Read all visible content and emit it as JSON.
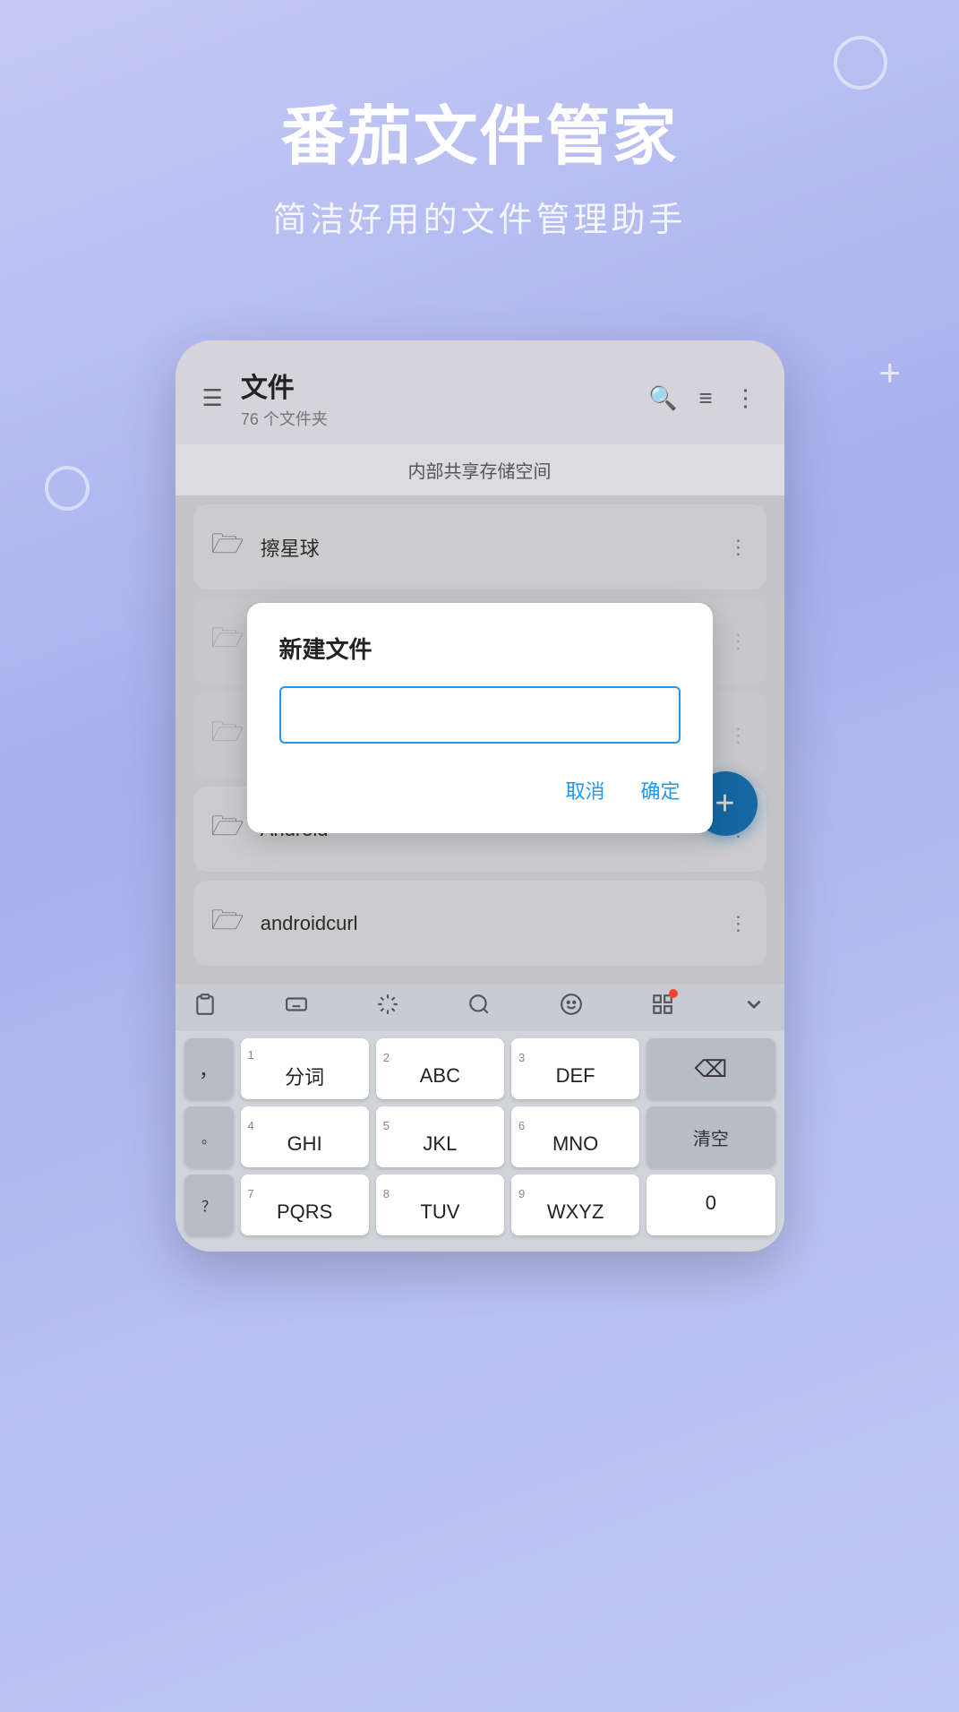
{
  "hero": {
    "title": "番茄文件管家",
    "subtitle": "简洁好用的文件管理助手"
  },
  "app": {
    "header": {
      "title": "文件",
      "subtitle": "76 个文件夹",
      "menu_icon": "≡",
      "search_icon": "🔍",
      "sort_icon": "≡",
      "more_icon": "⋮"
    },
    "storage_path": "内部共享存储空间",
    "files": [
      {
        "name": "擦星球",
        "icon": "□"
      },
      {
        "name": "Android",
        "icon": "□"
      },
      {
        "name": "androidcurl",
        "icon": "□"
      }
    ]
  },
  "dialog": {
    "title": "新建文件",
    "input_value": "",
    "input_placeholder": "",
    "cancel_label": "取消",
    "confirm_label": "确定"
  },
  "fab": {
    "label": "+"
  },
  "keyboard": {
    "toolbar_icons": [
      "clipboard",
      "keyboard",
      "cursor",
      "search",
      "emoji",
      "grid",
      "chevron-down"
    ],
    "rows": [
      [
        {
          "text": "，",
          "num": "",
          "type": "punct"
        },
        {
          "text": "分词",
          "num": "1",
          "type": "normal"
        },
        {
          "text": "ABC",
          "num": "2",
          "type": "normal"
        },
        {
          "text": "DEF",
          "num": "3",
          "type": "normal"
        },
        {
          "text": "⌫",
          "num": "",
          "type": "dark-wide"
        }
      ],
      [
        {
          "text": "。",
          "num": "",
          "type": "punct"
        },
        {
          "text": "GHI",
          "num": "4",
          "type": "normal"
        },
        {
          "text": "JKL",
          "num": "5",
          "type": "normal"
        },
        {
          "text": "MNO",
          "num": "6",
          "type": "normal"
        },
        {
          "text": "清空",
          "num": "",
          "type": "dark-wide"
        }
      ],
      [
        {
          "text": "？",
          "num": "",
          "type": "punct"
        },
        {
          "text": "PQRS",
          "num": "7",
          "type": "normal"
        },
        {
          "text": "TUV",
          "num": "8",
          "type": "normal"
        },
        {
          "text": "WXYZ",
          "num": "9",
          "type": "normal"
        },
        {
          "text": "0",
          "num": "",
          "type": "normal"
        }
      ]
    ]
  }
}
